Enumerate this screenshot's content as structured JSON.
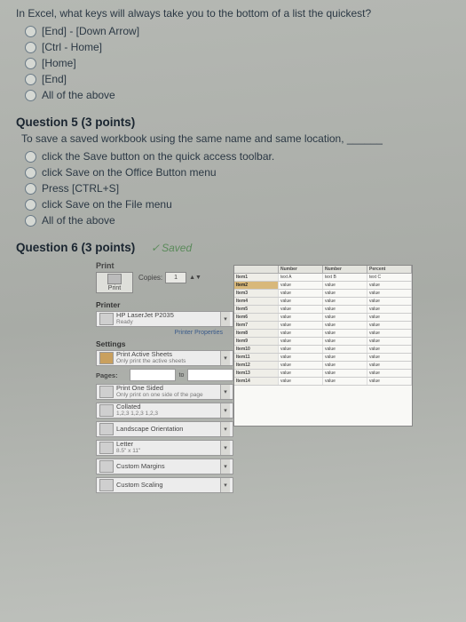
{
  "q4": {
    "stem": "In Excel, what keys will always take you to the bottom of a list the quickest?",
    "options": [
      "[End] - [Down Arrow]",
      "[Ctrl - Home]",
      "[Home]",
      "[End]",
      "All of the above"
    ]
  },
  "q5": {
    "heading": "Question 5 (3 points)",
    "sub": "To save a saved workbook using the same name and same location, ______",
    "options": [
      "click the Save button on the quick access toolbar.",
      "click Save on the Office Button menu",
      "Press [CTRL+S]",
      "click Save on the File menu",
      "All of the above"
    ]
  },
  "q6": {
    "heading": "Question 6 (3 points)",
    "saved_label": "Saved"
  },
  "print": {
    "title": "Print",
    "copies_label": "Copies:",
    "copies_value": "1",
    "print_btn": "Print",
    "printer_section": "Printer",
    "printer_name": "HP LaserJet P2035",
    "printer_status": "Ready",
    "printer_props": "Printer Properties",
    "settings_section": "Settings",
    "active_sheets_main": "Print Active Sheets",
    "active_sheets_sub": "Only print the active sheets",
    "pages_label": "Pages:",
    "pages_to": "to",
    "one_sided_main": "Print One Sided",
    "one_sided_sub": "Only print on one side of the page",
    "collated_main": "Collated",
    "collated_sub": "1,2,3  1,2,3  1,2,3",
    "orientation": "Landscape Orientation",
    "letter_main": "Letter",
    "letter_sub": "8.5\" x 11\"",
    "margins": "Custom Margins",
    "scaling": "Custom Scaling"
  },
  "preview": {
    "headers": [
      "",
      "Number",
      "Number",
      "Percent"
    ],
    "rows": [
      [
        "Item1",
        "text A",
        "text B",
        "text C"
      ],
      [
        "Item2",
        "value",
        "value",
        "value"
      ],
      [
        "Item3",
        "value",
        "value",
        "value"
      ],
      [
        "Item4",
        "value",
        "value",
        "value"
      ],
      [
        "Item5",
        "value",
        "value",
        "value"
      ],
      [
        "Item6",
        "value",
        "value",
        "value"
      ],
      [
        "Item7",
        "value",
        "value",
        "value"
      ],
      [
        "Item8",
        "value",
        "value",
        "value"
      ],
      [
        "Item9",
        "value",
        "value",
        "value"
      ],
      [
        "Item10",
        "value",
        "value",
        "value"
      ],
      [
        "Item11",
        "value",
        "value",
        "value"
      ],
      [
        "Item12",
        "value",
        "value",
        "value"
      ],
      [
        "Item13",
        "value",
        "value",
        "value"
      ],
      [
        "Item14",
        "value",
        "value",
        "value"
      ]
    ]
  }
}
